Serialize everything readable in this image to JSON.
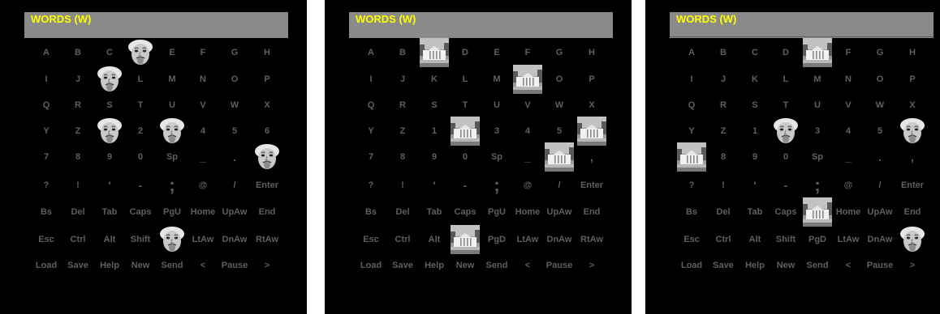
{
  "header_title": "WORDS (W)",
  "key_rows": [
    [
      "A",
      "B",
      "C",
      "D",
      "E",
      "F",
      "G",
      "H"
    ],
    [
      "I",
      "J",
      "K",
      "L",
      "M",
      "N",
      "O",
      "P"
    ],
    [
      "Q",
      "R",
      "S",
      "T",
      "U",
      "V",
      "W",
      "X"
    ],
    [
      "Y",
      "Z",
      "1",
      "2",
      "3",
      "4",
      "5",
      "6"
    ],
    [
      "7",
      "8",
      "9",
      "0",
      "Sp",
      "_",
      ".",
      ","
    ],
    [
      "?",
      "!",
      "'",
      "-",
      ";",
      "@",
      "/",
      "Enter"
    ],
    [
      "Bs",
      "Del",
      "Tab",
      "Caps",
      "PgU",
      "Home",
      "UpAw",
      "End"
    ],
    [
      "Esc",
      "Ctrl",
      "Alt",
      "Shift",
      "PgD",
      "LtAw",
      "DnAw",
      "RtAw"
    ],
    [
      "Load",
      "Save",
      "Help",
      "New",
      "Send",
      "<",
      "Pause",
      ">"
    ]
  ],
  "panels": [
    {
      "flashes": [
        {
          "row": 0,
          "col": 3,
          "type": "face"
        },
        {
          "row": 1,
          "col": 2,
          "type": "face"
        },
        {
          "row": 3,
          "col": 2,
          "type": "face"
        },
        {
          "row": 3,
          "col": 4,
          "type": "face"
        },
        {
          "row": 4,
          "col": 7,
          "type": "face"
        },
        {
          "row": 7,
          "col": 4,
          "type": "face"
        }
      ]
    },
    {
      "flashes": [
        {
          "row": 0,
          "col": 2,
          "type": "house"
        },
        {
          "row": 1,
          "col": 5,
          "type": "house"
        },
        {
          "row": 3,
          "col": 3,
          "type": "house"
        },
        {
          "row": 3,
          "col": 7,
          "type": "house"
        },
        {
          "row": 4,
          "col": 6,
          "type": "house"
        },
        {
          "row": 7,
          "col": 3,
          "type": "house"
        }
      ]
    },
    {
      "flashes": [
        {
          "row": 0,
          "col": 4,
          "type": "house"
        },
        {
          "row": 3,
          "col": 3,
          "type": "face"
        },
        {
          "row": 3,
          "col": 7,
          "type": "face"
        },
        {
          "row": 4,
          "col": 0,
          "type": "house"
        },
        {
          "row": 6,
          "col": 4,
          "type": "house"
        },
        {
          "row": 7,
          "col": 7,
          "type": "face"
        }
      ]
    }
  ],
  "colors": {
    "panel_bg": "#000000",
    "header_bg": "#8a8a8a",
    "title": "#ffff00",
    "key_text": "#5f5f5f"
  },
  "icons": {
    "face": "einstein-face-icon",
    "house": "white-house-icon"
  }
}
